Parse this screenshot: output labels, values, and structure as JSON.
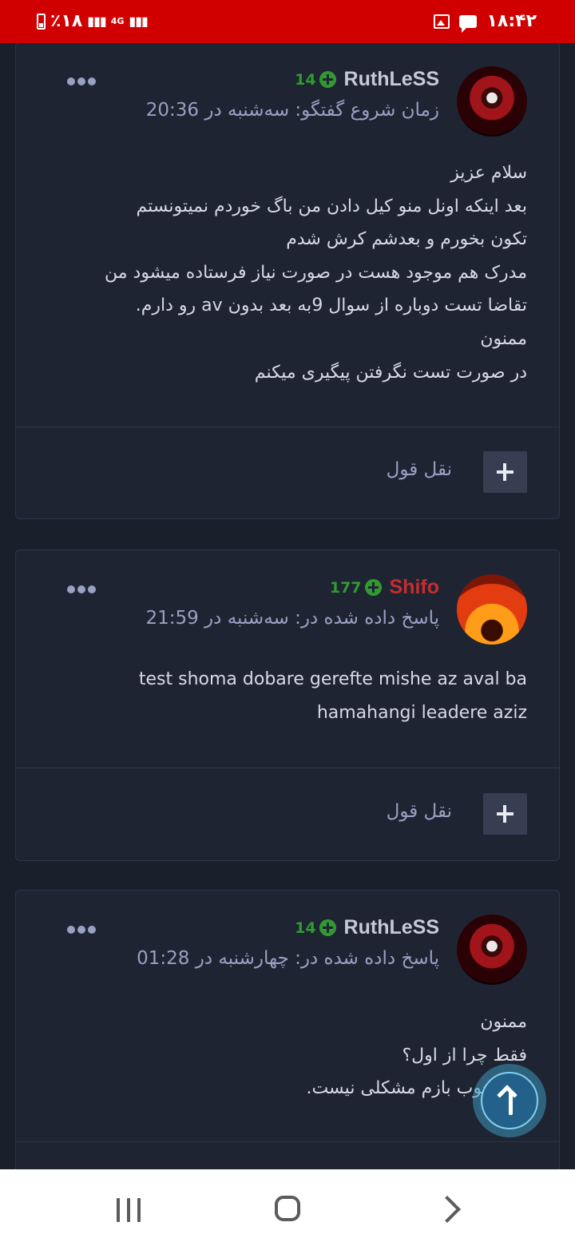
{
  "status_bar": {
    "time": "۱۸:۴۲",
    "battery": "٪۱۸",
    "network": "4G"
  },
  "posts": [
    {
      "author": "RuthLeSS",
      "author_color": "#c5cad6",
      "reputation": "14",
      "date": "زمان شروع گفتگو: سه‌شنبه در 20:36",
      "lines": [
        "سلام عزیز",
        "بعد اینکه اونل منو کیل دادن من باگ خوردم نمیتونستم",
        "تکون بخورم و بعدشم کرش شدم",
        "مدرک هم موجود هست در صورت نیاز فرستاده میشود من",
        "تقاضا تست دوباره از سوال 9به بعد بدون av رو دارم.",
        "ممنون",
        "در صورت تست نگرفتن پیگیری میکنم"
      ],
      "quote_label": "نقل قول"
    },
    {
      "author": "Shifo",
      "author_color": "#c62d2d",
      "reputation": "177",
      "date": "پاسخ داده شده در: سه‌شنبه در 21:59",
      "lines": [
        "test shoma dobare gerefte mishe az aval ba",
        "hamahangi leadere aziz"
      ],
      "quote_label": "نقل قول"
    },
    {
      "author": "RuthLeSS",
      "author_color": "#c5cad6",
      "reputation": "14",
      "date": "پاسخ داده شده در: چهارشنبه در 01:28",
      "lines": [
        "ممنون",
        "فقط چرا از اول؟",
        "ولی خوب بازم مشکلی نیست."
      ]
    }
  ],
  "icons": {
    "reputation": "plus-circle-icon",
    "options": "more-dots-icon",
    "quote": "plus-icon",
    "scroll_top": "arrow-up-icon"
  }
}
